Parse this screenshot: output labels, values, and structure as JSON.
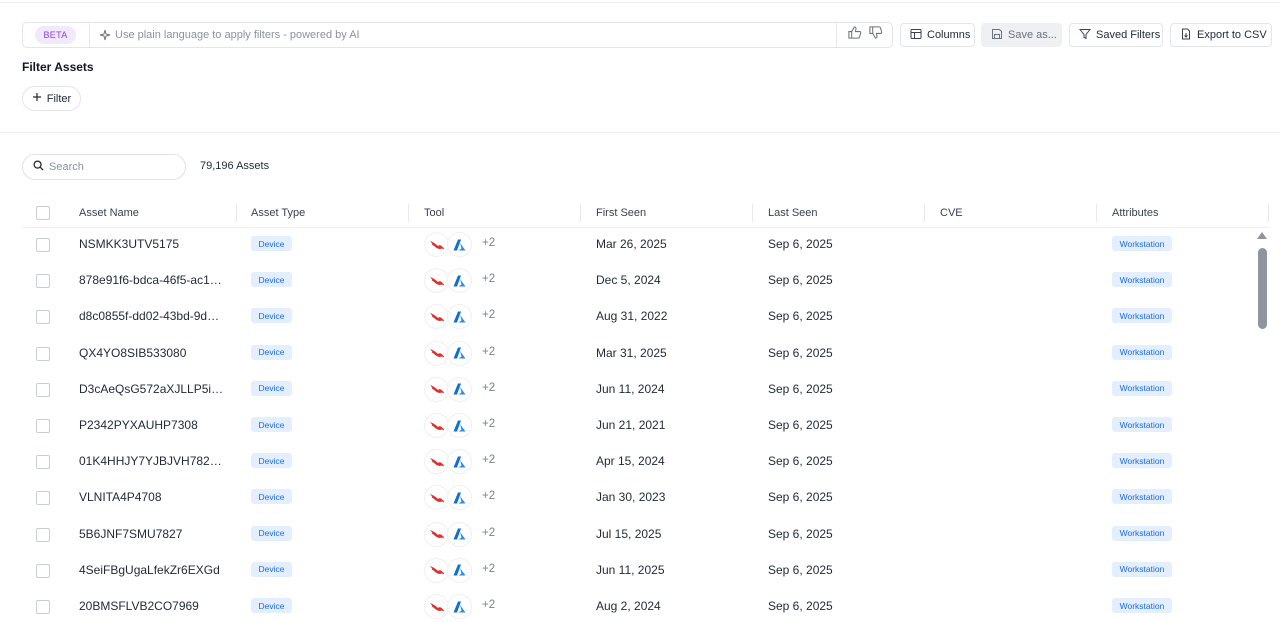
{
  "toolbar": {
    "beta_label": "BETA",
    "ai_placeholder": "Use plain language to apply filters - powered by AI",
    "columns_label": "Columns",
    "save_as_label": "Save as...",
    "saved_filters_label": "Saved Filters",
    "export_label": "Export to CSV"
  },
  "filters": {
    "title": "Filter Assets",
    "add_filter_label": "Filter"
  },
  "search": {
    "placeholder": "Search",
    "asset_count": "79,196 Assets"
  },
  "table": {
    "headers": [
      "Asset Name",
      "Asset Type",
      "Tool",
      "First Seen",
      "Last Seen",
      "CVE",
      "Attributes"
    ],
    "rows": [
      {
        "name": "NSMKK3UTV5175",
        "type": "Device",
        "tools_more": "+2",
        "first_seen": "Mar 26, 2025",
        "last_seen": "Sep 6, 2025",
        "cve": "",
        "attribute": "Workstation"
      },
      {
        "name": "878e91f6-bdca-46f5-ac1…",
        "type": "Device",
        "tools_more": "+2",
        "first_seen": "Dec 5, 2024",
        "last_seen": "Sep 6, 2025",
        "cve": "",
        "attribute": "Workstation"
      },
      {
        "name": "d8c0855f-dd02-43bd-9d…",
        "type": "Device",
        "tools_more": "+2",
        "first_seen": "Aug 31, 2022",
        "last_seen": "Sep 6, 2025",
        "cve": "",
        "attribute": "Workstation"
      },
      {
        "name": "QX4YO8SIB533080",
        "type": "Device",
        "tools_more": "+2",
        "first_seen": "Mar 31, 2025",
        "last_seen": "Sep 6, 2025",
        "cve": "",
        "attribute": "Workstation"
      },
      {
        "name": "D3cAeQsG572aXJLLP5i…",
        "type": "Device",
        "tools_more": "+2",
        "first_seen": "Jun 11, 2024",
        "last_seen": "Sep 6, 2025",
        "cve": "",
        "attribute": "Workstation"
      },
      {
        "name": "P2342PYXAUHP7308",
        "type": "Device",
        "tools_more": "+2",
        "first_seen": "Jun 21, 2021",
        "last_seen": "Sep 6, 2025",
        "cve": "",
        "attribute": "Workstation"
      },
      {
        "name": "01K4HHJY7YJBJVH782…",
        "type": "Device",
        "tools_more": "+2",
        "first_seen": "Apr 15, 2024",
        "last_seen": "Sep 6, 2025",
        "cve": "",
        "attribute": "Workstation"
      },
      {
        "name": "VLNITA4P4708",
        "type": "Device",
        "tools_more": "+2",
        "first_seen": "Jan 30, 2023",
        "last_seen": "Sep 6, 2025",
        "cve": "",
        "attribute": "Workstation"
      },
      {
        "name": "5B6JNF7SMU7827",
        "type": "Device",
        "tools_more": "+2",
        "first_seen": "Jul 15, 2025",
        "last_seen": "Sep 6, 2025",
        "cve": "",
        "attribute": "Workstation"
      },
      {
        "name": "4SeiFBgUgaLfekZr6EXGd",
        "type": "Device",
        "tools_more": "+2",
        "first_seen": "Jun 11, 2025",
        "last_seen": "Sep 6, 2025",
        "cve": "",
        "attribute": "Workstation"
      },
      {
        "name": "20BMSFLVB2CO7969",
        "type": "Device",
        "tools_more": "+2",
        "first_seen": "Aug 2, 2024",
        "last_seen": "Sep 6, 2025",
        "cve": "",
        "attribute": "Workstation"
      }
    ],
    "tool_icons": [
      "falcon-icon",
      "azure-icon"
    ]
  },
  "colors": {
    "beta_bg": "#f1e9fd",
    "beta_text": "#8b3fd9",
    "badge_bg": "#e3efff",
    "badge_text": "#1d6ae5",
    "falcon_red": "#e0312f",
    "azure_blue": "#0f6fd3"
  }
}
